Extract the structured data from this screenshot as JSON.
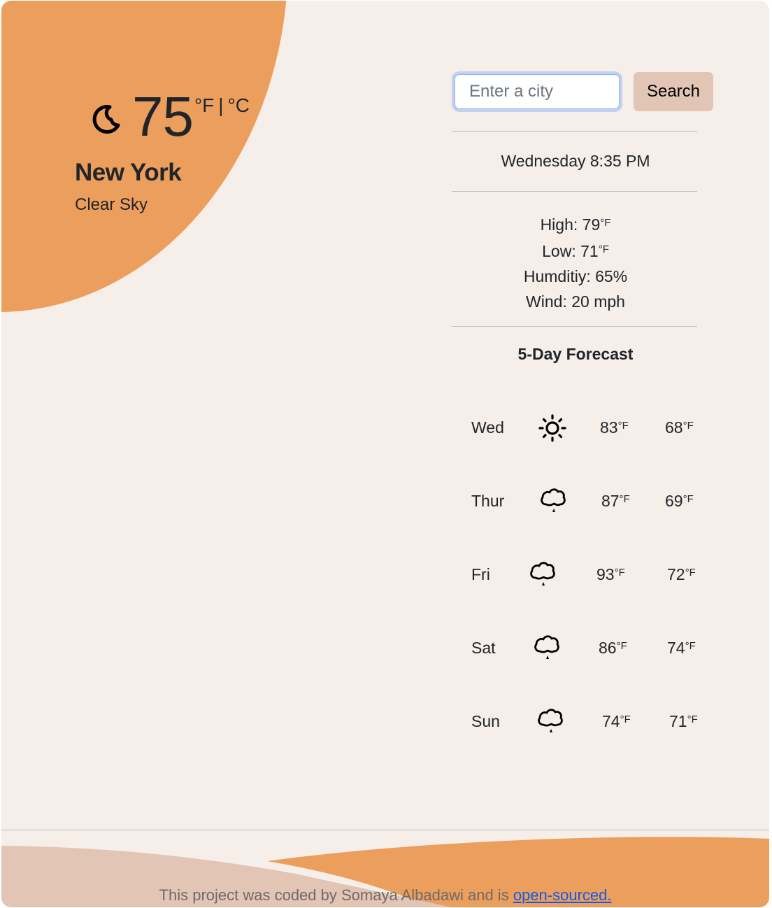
{
  "current": {
    "icon": "moon-icon",
    "temperature": "75",
    "unit_f": "°F",
    "unit_separator": "|",
    "unit_c": "°C",
    "city": "New York",
    "description": "Clear Sky"
  },
  "search": {
    "placeholder": "Enter a city",
    "value": "",
    "button_label": "Search"
  },
  "datetime": "Wednesday 8:35 PM",
  "stats": {
    "high_label": "High: ",
    "high_value": "79",
    "low_label": "Low: ",
    "low_value": "71",
    "degree_unit": "°F",
    "humidity": "Humditiy: 65%",
    "wind": "Wind: 20 mph"
  },
  "forecast": {
    "title": "5-Day Forecast",
    "unit": "°F",
    "days": [
      {
        "day": "Wed",
        "icon": "sun-icon",
        "high": "83",
        "low": "68"
      },
      {
        "day": "Thur",
        "icon": "rain-cloud-icon",
        "high": "87",
        "low": "69"
      },
      {
        "day": "Fri",
        "icon": "rain-cloud-icon",
        "high": "93",
        "low": "72"
      },
      {
        "day": "Sat",
        "icon": "rain-cloud-icon",
        "high": "86",
        "low": "74"
      },
      {
        "day": "Sun",
        "icon": "rain-cloud-icon",
        "high": "74",
        "low": "71"
      }
    ]
  },
  "footer": {
    "text": "This project was coded by Somaya Albadawi and is ",
    "link_label": "open-sourced."
  },
  "colors": {
    "background": "#f5eee9",
    "accent_orange": "#ec9e5d",
    "accent_tan": "#e2c5b4",
    "link": "#0d5bf0"
  }
}
